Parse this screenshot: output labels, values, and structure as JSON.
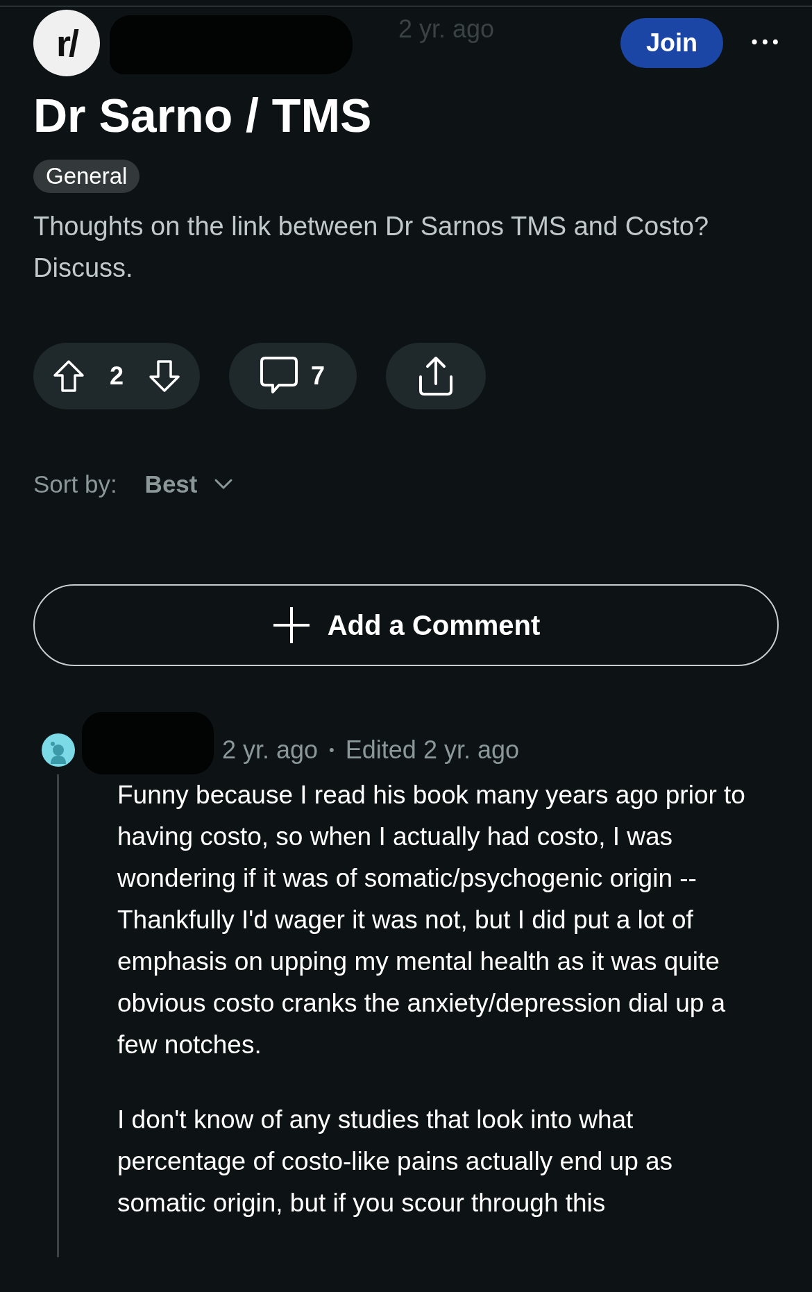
{
  "post": {
    "community_icon": "r/",
    "time": "2 yr. ago",
    "join_button": "Join",
    "more_button": "•••",
    "title": "Dr Sarno / TMS",
    "flair": "General",
    "body": "Thoughts on the link between Dr Sarnos TMS and Costo? Discuss.",
    "votes": "2",
    "comments": "7"
  },
  "sort": {
    "label": "Sort by:",
    "value": "Best"
  },
  "add_comment": "Add a Comment",
  "comment": {
    "time": "2 yr. ago",
    "separator": "•",
    "edited": "Edited 2 yr. ago",
    "paragraphs": [
      "Funny because I read his book many years ago prior to having costo, so when I actually had costo, I was wondering if it was of somatic/psychogenic origin -- Thankfully I'd wager it was not, but I did put a lot of emphasis on upping my mental health as it was quite obvious costo cranks the anxiety/depression dial up a few notches.",
      "I don't know of any studies that look into what percentage of costo-like pains actually end up as somatic origin, but if you scour through this"
    ]
  }
}
